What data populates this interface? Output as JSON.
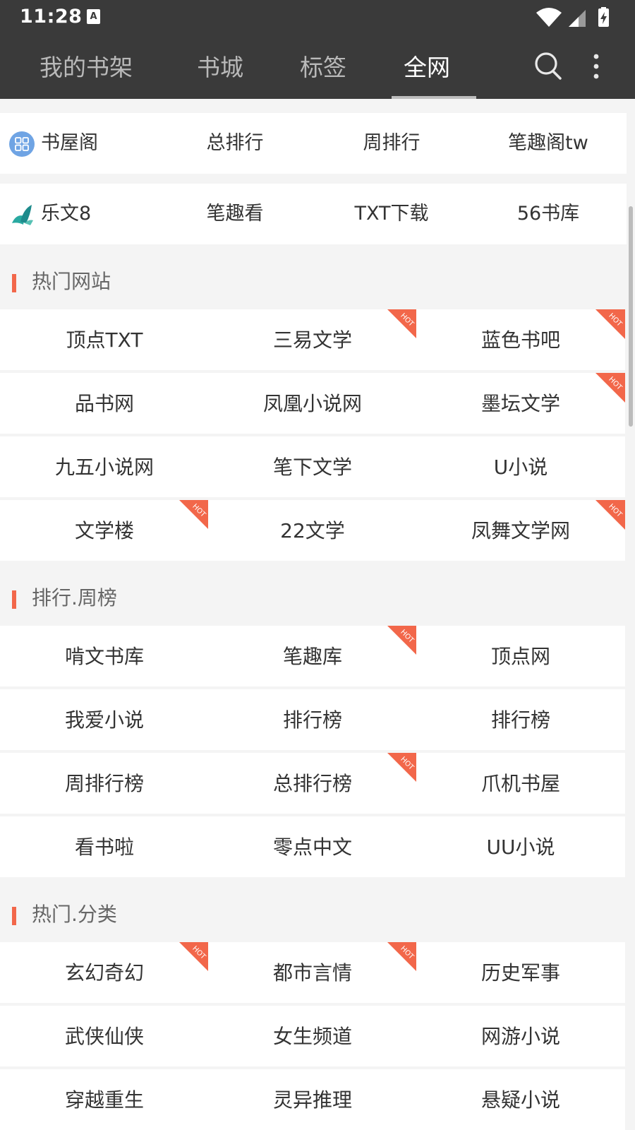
{
  "status_bar": {
    "time": "11:28",
    "notification_icon": "A"
  },
  "tabs": [
    {
      "label": "我的书架",
      "active": false
    },
    {
      "label": "书城",
      "active": false
    },
    {
      "label": "标签",
      "active": false
    },
    {
      "label": "全网",
      "active": true
    }
  ],
  "app_bar": {
    "search_icon": "search-icon",
    "more_icon": "more-vert-icon"
  },
  "sources": {
    "row1": [
      "书屋阁",
      "总排行",
      "周排行",
      "笔趣阁tw"
    ],
    "row2": [
      "乐文8",
      "笔趣看",
      "TXT下载",
      "56书库"
    ]
  },
  "sections": [
    {
      "title": "热门网站",
      "items": [
        {
          "label": "顶点TXT",
          "hot": false
        },
        {
          "label": "三易文学",
          "hot": true
        },
        {
          "label": "蓝色书吧",
          "hot": true
        },
        {
          "label": "品书网",
          "hot": false
        },
        {
          "label": "凤凰小说网",
          "hot": false
        },
        {
          "label": "墨坛文学",
          "hot": true
        },
        {
          "label": "九五小说网",
          "hot": false
        },
        {
          "label": "笔下文学",
          "hot": false
        },
        {
          "label": "U小说",
          "hot": false
        },
        {
          "label": "文学楼",
          "hot": true
        },
        {
          "label": "22文学",
          "hot": false
        },
        {
          "label": "凤舞文学网",
          "hot": true
        }
      ]
    },
    {
      "title": "排行.周榜",
      "items": [
        {
          "label": "啃文书库",
          "hot": false
        },
        {
          "label": "笔趣库",
          "hot": true
        },
        {
          "label": "顶点网",
          "hot": false
        },
        {
          "label": "我爱小说",
          "hot": false
        },
        {
          "label": "排行榜",
          "hot": false
        },
        {
          "label": "排行榜",
          "hot": false
        },
        {
          "label": "周排行榜",
          "hot": false
        },
        {
          "label": "总排行榜",
          "hot": true
        },
        {
          "label": "爪机书屋",
          "hot": false
        },
        {
          "label": "看书啦",
          "hot": false
        },
        {
          "label": "零点中文",
          "hot": false
        },
        {
          "label": "UU小说",
          "hot": false
        }
      ]
    },
    {
      "title": "热门.分类",
      "items": [
        {
          "label": "玄幻奇幻",
          "hot": true
        },
        {
          "label": "都市言情",
          "hot": true
        },
        {
          "label": "历史军事",
          "hot": false
        },
        {
          "label": "武侠仙侠",
          "hot": false
        },
        {
          "label": "女生频道",
          "hot": false
        },
        {
          "label": "网游小说",
          "hot": false
        },
        {
          "label": "穿越重生",
          "hot": false
        },
        {
          "label": "灵异推理",
          "hot": false
        },
        {
          "label": "悬疑小说",
          "hot": false
        }
      ]
    }
  ],
  "hot_badge_text": "HOT",
  "colors": {
    "header_bg": "#3a3a3a",
    "accent": "#f2674a",
    "page_bg": "#f4f4f4"
  }
}
